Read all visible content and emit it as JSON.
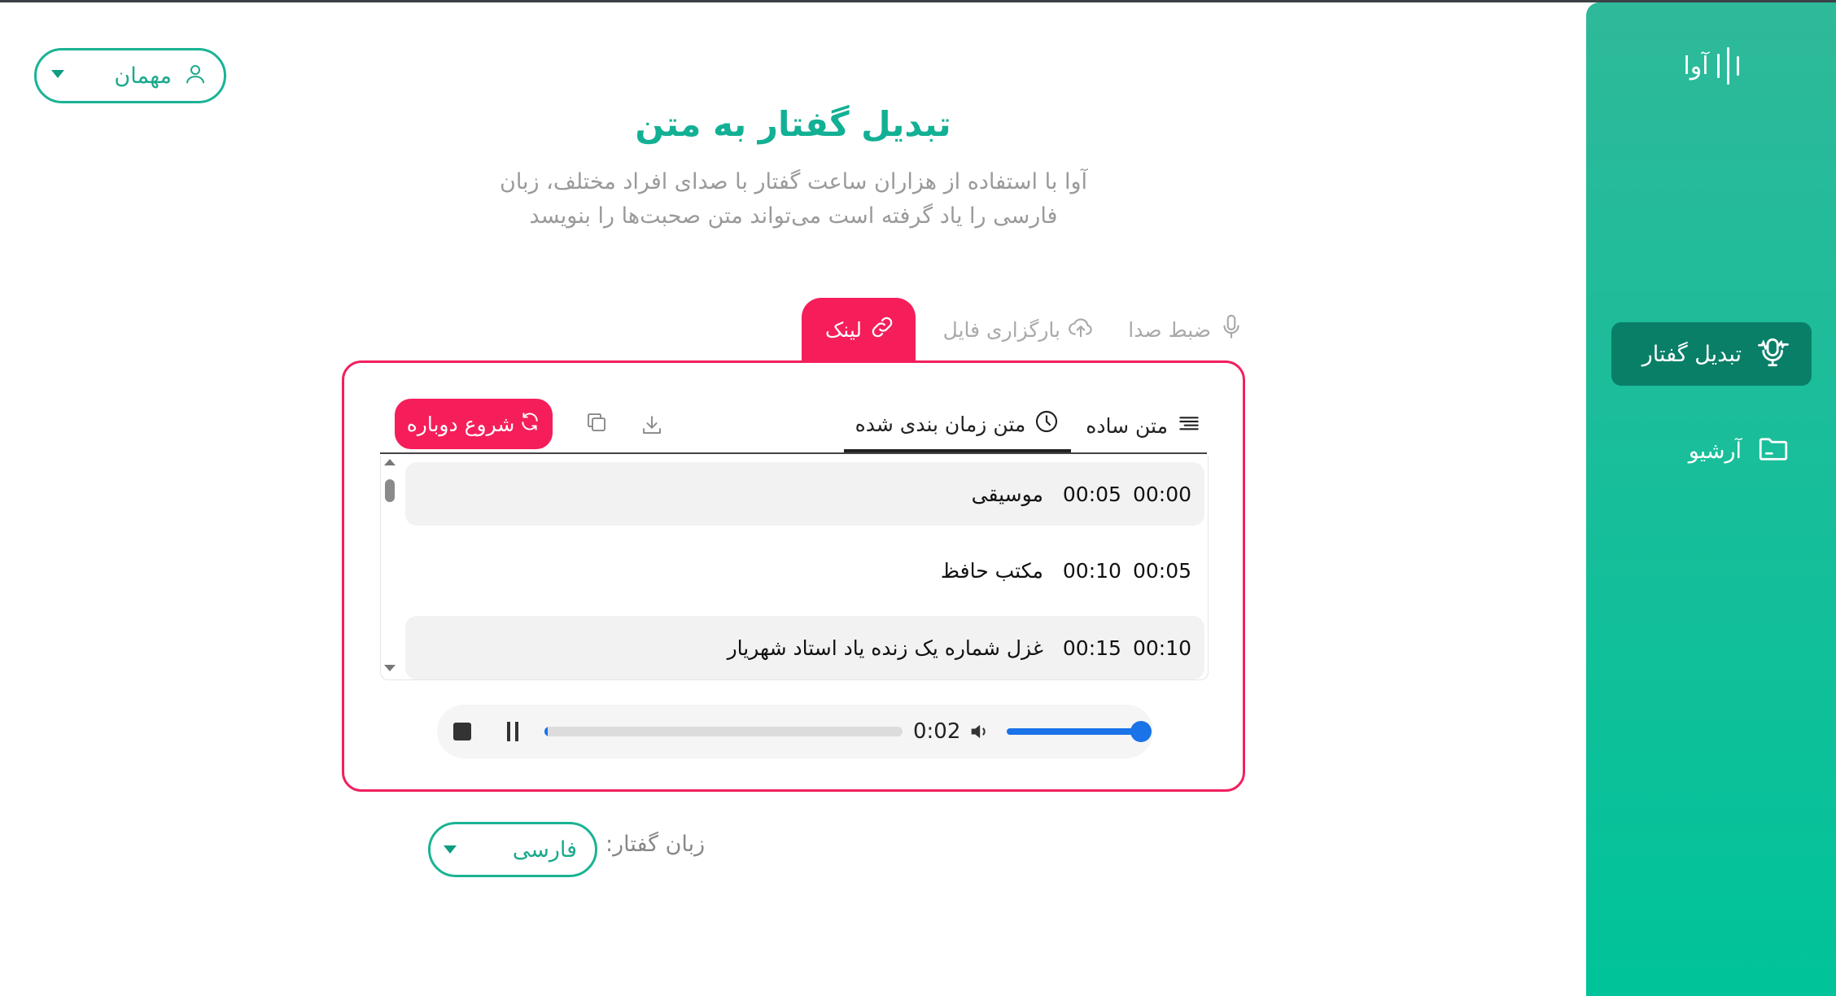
{
  "app": {
    "logo_text": "آوا"
  },
  "sidebar": {
    "items": [
      {
        "label": "تبدیل گفتار",
        "icon": "mic-wave-icon",
        "active": true
      },
      {
        "label": "آرشیو",
        "icon": "folder-icon",
        "active": false
      }
    ]
  },
  "user": {
    "name": "مهمان",
    "icon": "user-icon"
  },
  "header": {
    "title": "تبدیل گفتار به متن",
    "subtitle_line1": "آوا با استفاده از هزاران ساعت گفتار با صدای افراد مختلف، زبان",
    "subtitle_line2": "فارسی را یاد گرفته است می‌تواند متن صحبت‌ها را بنویسد"
  },
  "input_tabs": [
    {
      "label": "ضبط صدا",
      "icon": "mic-icon"
    },
    {
      "label": "بارگزاری فایل",
      "icon": "cloud-upload-icon"
    },
    {
      "label": "لینک",
      "icon": "link-icon",
      "active": true
    }
  ],
  "result": {
    "restart_label": "شروع دوباره",
    "tabs": [
      {
        "label": "متن ساده",
        "icon": "lines-icon"
      },
      {
        "label": "متن زمان بندی شده",
        "icon": "clock-icon",
        "active": true
      }
    ],
    "segments": [
      {
        "start": "00:00",
        "end": "00:05",
        "text": "موسیقی"
      },
      {
        "start": "00:05",
        "end": "00:10",
        "text": "مکتب حافظ"
      },
      {
        "start": "00:10",
        "end": "00:15",
        "text": "غزل شماره یک زنده یاد استاد شهریار"
      }
    ]
  },
  "player": {
    "current_time": "0:02",
    "progress": 0.01,
    "volume": 1.0
  },
  "language": {
    "label": "زبان گفتار:",
    "selected": "فارسی"
  },
  "colors": {
    "accent_green": "#00c39a",
    "accent_pink": "#f51e5a",
    "active_sidebar": "#0a7f68"
  }
}
